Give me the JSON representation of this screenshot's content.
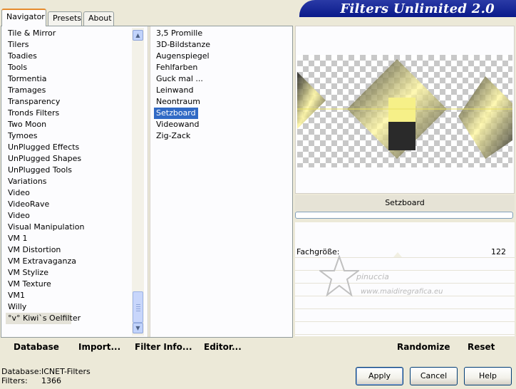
{
  "banner": {
    "title": "Filters Unlimited 2.0"
  },
  "tabs": [
    {
      "label": "Navigator",
      "active": true
    },
    {
      "label": "Presets",
      "active": false
    },
    {
      "label": "About",
      "active": false
    }
  ],
  "categories": [
    "Tile & Mirror",
    "Tilers",
    "Toadies",
    "Tools",
    "Tormentia",
    "Tramages",
    "Transparency",
    "Tronds Filters",
    "Two Moon",
    "Tymoes",
    "UnPlugged Effects",
    "UnPlugged Shapes",
    "UnPlugged Tools",
    "Variations",
    "Video",
    "VideoRave",
    "Video",
    "Visual Manipulation",
    "VM 1",
    "VM Distortion",
    "VM Extravaganza",
    "VM Stylize",
    "VM Texture",
    "VM1",
    "Willy",
    "°v° Kiwi`s Oelfilter"
  ],
  "filters": [
    "3,5 Promille",
    "3D-Bildstanze",
    "Augenspiegel",
    "Fehlfarben",
    "Guck mal ...",
    "Leinwand",
    "Neontraum",
    "Setzboard",
    "Videowand",
    "Zig-Zack"
  ],
  "selected_category_index": 25,
  "selected_filter_index": 7,
  "bottom_buttons": {
    "database": "Database",
    "import": "Import...",
    "filter_info": "Filter Info...",
    "editor": "Editor...",
    "randomize": "Randomize",
    "reset": "Reset"
  },
  "preview": {
    "filter_name": "Setzboard",
    "progress": 0
  },
  "params": [
    {
      "label": "Fachgröße:",
      "value": "122"
    }
  ],
  "watermark": {
    "line1": "pinuccia",
    "line2": "www.maidiregrafica.eu"
  },
  "status": {
    "database_label": "Database:",
    "database_value": "ICNET-Filters",
    "filters_label": "Filters:",
    "filters_value": "1366"
  },
  "dialog_buttons": {
    "apply": "Apply",
    "cancel": "Cancel",
    "help": "Help"
  },
  "icons": {
    "scroll_up": "chevron-up-icon",
    "scroll_down": "chevron-down-icon"
  },
  "colors": {
    "accent_tab": "#e68b2c",
    "selection": "#316ac5",
    "banner": "#0a1a8a"
  }
}
